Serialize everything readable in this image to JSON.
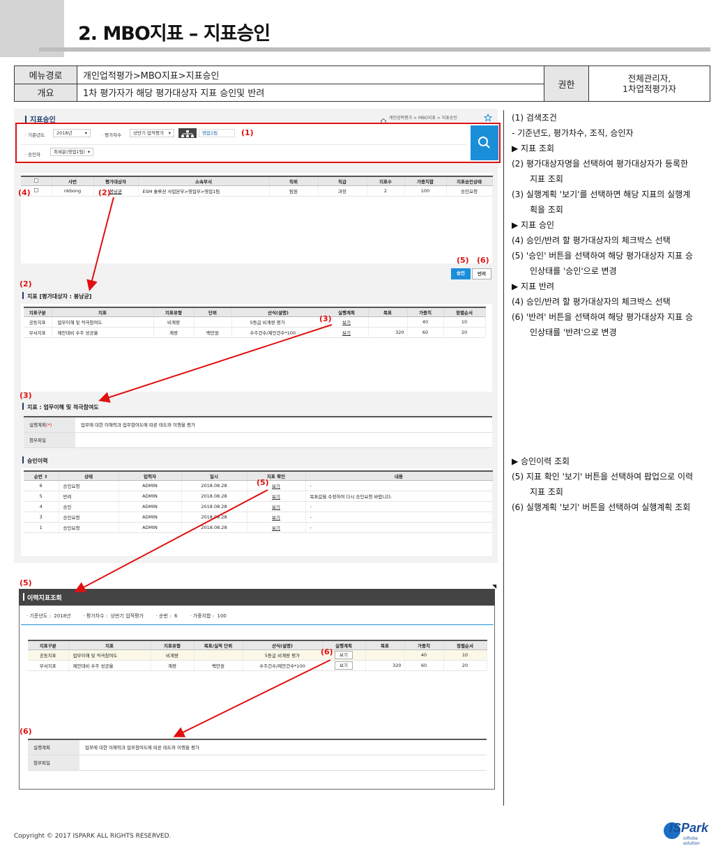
{
  "page": {
    "title": "2. MBO지표 – 지표승인",
    "footer": "Copyright © 2017 ISPARK ALL RIGHTS RESERVED.",
    "logo_text": "ISPark",
    "logo_sub": "infinite solution"
  },
  "meta": {
    "menu_label": "메뉴경로",
    "menu_value": "개인업적평가>MBO지표>지표승인",
    "summary_label": "개요",
    "summary_value": "1차 평가자가 해당 평가대상자 지표 승인및 반려",
    "auth_label": "권한",
    "auth_value_1": "전체관리자,",
    "auth_value_2": "1차업적평가자"
  },
  "screen": {
    "panel_title": "지표승인",
    "breadcrumb": "개인업적평가  >  MBO지표  >  지표승인",
    "search": {
      "year_label": "· 기준년도",
      "year_value": "2018년",
      "round_label": "· 평가차수",
      "round_value": "상반기 업적평가",
      "org_value": "영업1팀",
      "approver_label": "· 승인자",
      "approver_value": "최세운(영업1팀)"
    },
    "target_table": {
      "headers": [
        "",
        "사번",
        "평가대상자",
        "소속부서",
        "직위",
        "직급",
        "지표수",
        "가중치합",
        "지표승인상태"
      ],
      "row": {
        "emp": "nkbong",
        "name": "봉낭균",
        "dept": "ESM 솔루션 사업본부>영업부>영업1팀",
        "position": "팀원",
        "grade": "과장",
        "count": "2",
        "weight": "100",
        "status": "승인요청"
      }
    },
    "approve_btn": "승인",
    "reject_btn": "반려",
    "indicator_title": "지표 [평가대상자 : 봉낭균]",
    "indicator_table": {
      "headers": [
        "지표구분",
        "지표",
        "지표유형",
        "단위",
        "산식(설명)",
        "실행계획",
        "목표",
        "가중치",
        "정렬순서"
      ],
      "rows": [
        [
          "공동지표",
          "업무이해 및 적극참여도",
          "비계량",
          "",
          "5등급 비계량 평가",
          "보기",
          "",
          "40",
          "10"
        ],
        [
          "부서지표",
          "제안대비 수주 성공율",
          "계량",
          "백만원",
          "수주건수/제안건수*100",
          "보기",
          "320",
          "60",
          "20"
        ]
      ]
    },
    "detail_title": "지표 : 업무이해 및 적극참여도",
    "detail": {
      "plan_label": "실행계획",
      "plan_required": "(*)",
      "plan_value": "업무에 대한 이해력과 업무참여도에 따른 태도와 이행을 평가",
      "file_label": "첨부파일"
    },
    "history_title": "승인이력",
    "history_table": {
      "headers": [
        "순번 ⇕",
        "상태",
        "입력자",
        "일시",
        "지표 확인",
        "내용"
      ],
      "rows": [
        [
          "6",
          "승인요청",
          "ADMIN",
          "2018.08.28",
          "보기",
          "-"
        ],
        [
          "5",
          "반려",
          "ADMIN",
          "2018.08.28",
          "보기",
          "목표값을 수정하여 다시 승인요청 바랍니다."
        ],
        [
          "4",
          "승인",
          "ADMIN",
          "2018.08.28",
          "보기",
          "-"
        ],
        [
          "3",
          "승인요청",
          "ADMIN",
          "2018.08.28",
          "보기",
          "-"
        ],
        [
          "1",
          "승인요청",
          "ADMIN",
          "2018.08.28",
          "보기",
          "-"
        ]
      ]
    }
  },
  "popup": {
    "title": "이력지표조회",
    "info": "· 기준년도 :  2018년        · 평가차수 :  상반기 업적평가        · 순번 :  6        · 가중치합 :  100",
    "table": {
      "headers": [
        "지표구분",
        "지표",
        "지표유형",
        "목표/실적 단위",
        "산식(설명)",
        "실행계획",
        "목표",
        "가중치",
        "정렬순서"
      ],
      "rows": [
        [
          "공동지표",
          "업무이해 및 적극참여도",
          "비계량",
          "",
          "5등급 비계량 평가",
          "보기",
          "",
          "40",
          "10"
        ],
        [
          "부서지표",
          "제안대비 수주 성공율",
          "계량",
          "백만원",
          "수주건수/제안건수*100",
          "보기",
          "320",
          "60",
          "20"
        ]
      ]
    },
    "plan_label": "실행계획",
    "plan_value": "업무에 대한 이해력과 업무참여도에 따른 태도와 이행을 평가",
    "file_label": "첨부파일"
  },
  "markers": {
    "m1": "(1)",
    "m2": "(2)",
    "m3": "(3)",
    "m4": "(4)",
    "m5": "(5)",
    "m6": "(6)"
  },
  "notes_top": [
    "(1)   검색조건",
    "- 기준년도, 평가차수, 조직, 승인자",
    "▶ 지표 조회",
    "(2)   평가대상자명을 선택하여 평가대상자가 등록한",
    "지표 조회",
    "(3)   실행계획 '보기'를 선택하면 해당 지표의 실행계",
    "획을 조회",
    "▶ 지표 승인",
    "(4)   승인/반려 할 평가대상자의 체크박스 선택",
    "(5)   '승인' 버튼을 선택하여 해당 평가대상자 지표 승",
    "인상태를 '승인'으로 변경",
    "▶ 지표 반려",
    "(4)   승인/반려 할 평가대상자의 체크박스 선택",
    "(6)   '반려' 버튼을 선택하여 해당 평가대상자 지표 승",
    "인상태를 '반려'으로 변경"
  ],
  "notes_bottom": [
    "▶ 승인이력 조회",
    "(5)   지표 확인 '보기' 버튼을 선택하여 팝업으로 이력",
    "지표 조회",
    "(6)   실행계획 '보기' 버튼을 선택하여 실행계획 조회"
  ]
}
